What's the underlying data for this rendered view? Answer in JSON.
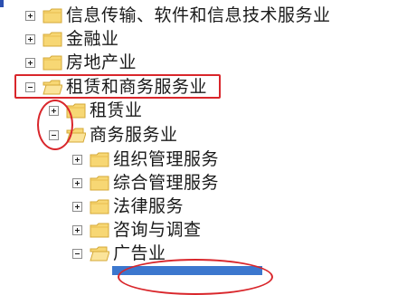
{
  "tree": {
    "items": [
      {
        "label": "信息传输、软件和信息技术服务业",
        "expander": "plus"
      },
      {
        "label": "金融业",
        "expander": "plus"
      },
      {
        "label": "房地产业",
        "expander": "plus"
      },
      {
        "label": "租赁和商务服务业",
        "expander": "minus"
      },
      {
        "label": "租赁业",
        "expander": "plus"
      },
      {
        "label": "商务服务业",
        "expander": "minus"
      },
      {
        "label": "组织管理服务",
        "expander": "plus"
      },
      {
        "label": "综合管理服务",
        "expander": "plus"
      },
      {
        "label": "法律服务",
        "expander": "plus"
      },
      {
        "label": "咨询与调查",
        "expander": "plus"
      },
      {
        "label": "广告业",
        "expander": "minus"
      }
    ]
  },
  "icons": {
    "expander_plus": "plus-square-icon",
    "expander_minus": "minus-square-icon",
    "folder": "folder-icon"
  },
  "colors": {
    "annotation": "#d9262b",
    "folder_fill": "#f7d774",
    "folder_edge": "#d4a837",
    "selection": "#3c77ce"
  }
}
